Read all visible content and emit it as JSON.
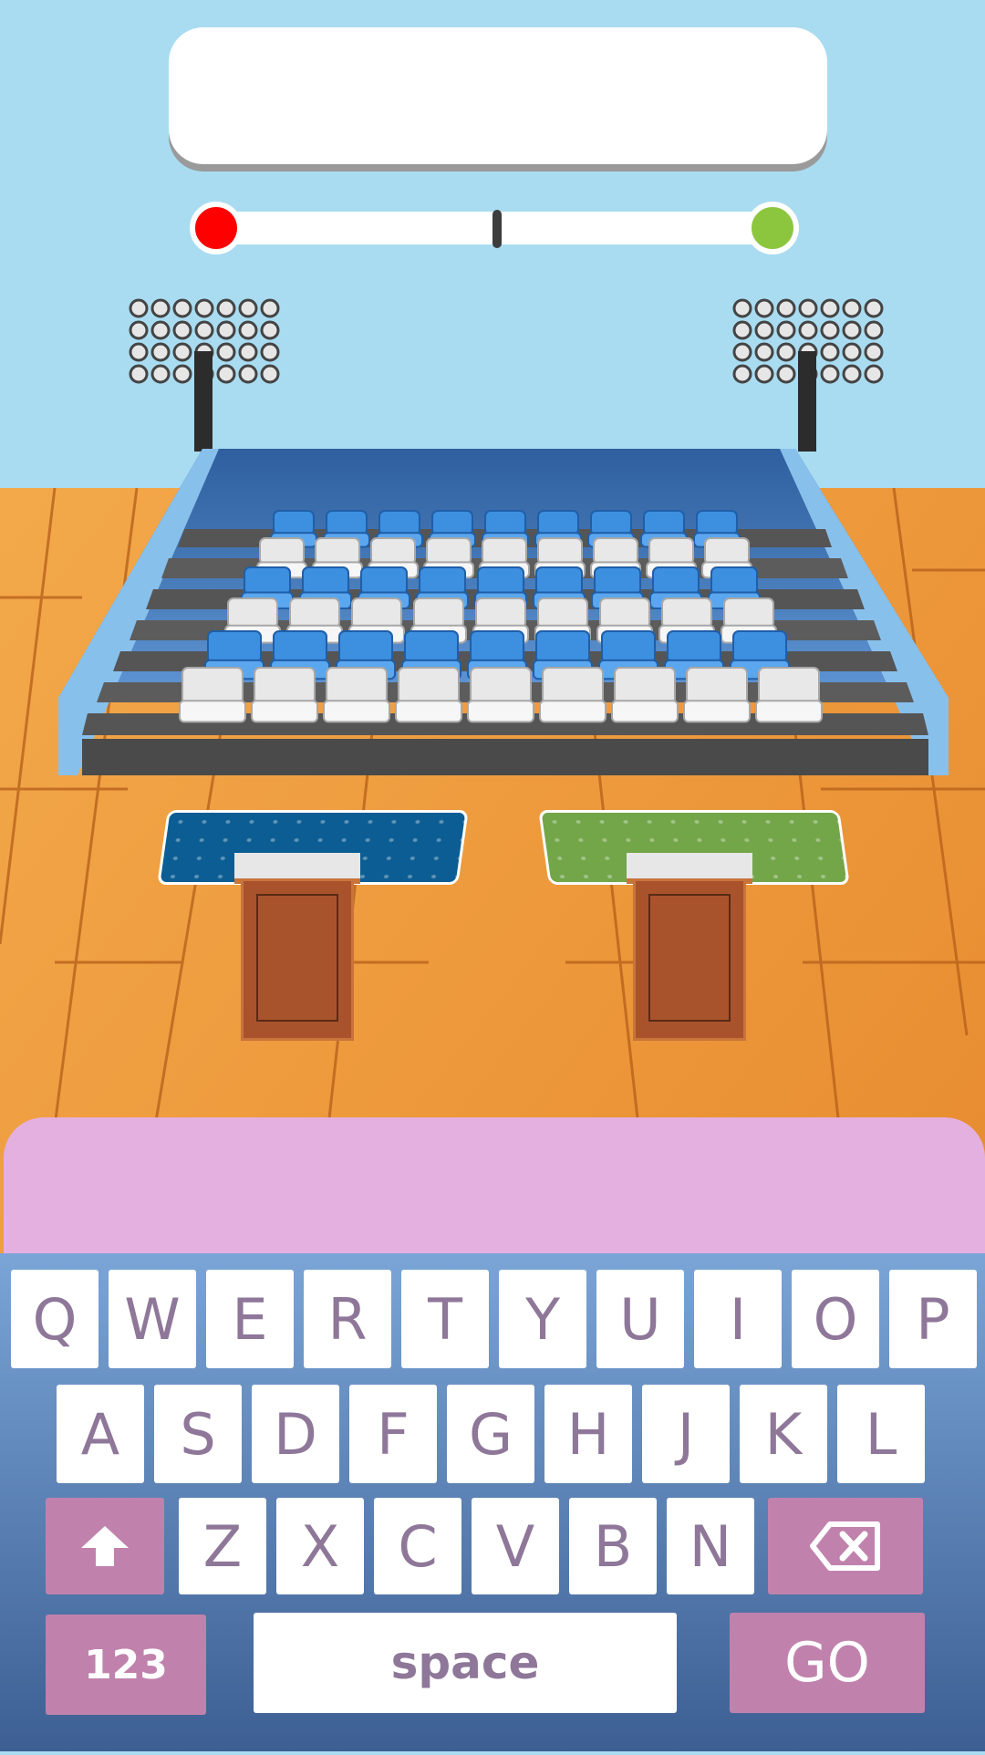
{
  "prompt": {
    "text": ""
  },
  "tray": {
    "text": ""
  },
  "meter": {
    "left_color": "#ff0000",
    "right_color": "#8cc63f",
    "marker_fraction": 0.5
  },
  "mats": {
    "left_color": "#0b5d93",
    "right_color": "#72a649"
  },
  "keyboard": {
    "row1": [
      "Q",
      "W",
      "E",
      "R",
      "T",
      "Y",
      "U",
      "I",
      "O",
      "P"
    ],
    "row2": [
      "A",
      "S",
      "D",
      "F",
      "G",
      "H",
      "J",
      "K",
      "L"
    ],
    "row3": [
      "Z",
      "X",
      "C",
      "V",
      "B",
      "N"
    ],
    "numbers_label": "123",
    "space_label": "space",
    "go_label": "GO",
    "key_color": "#ffffff",
    "special_color": "#c082ac",
    "letter_color": "#8e7799"
  }
}
